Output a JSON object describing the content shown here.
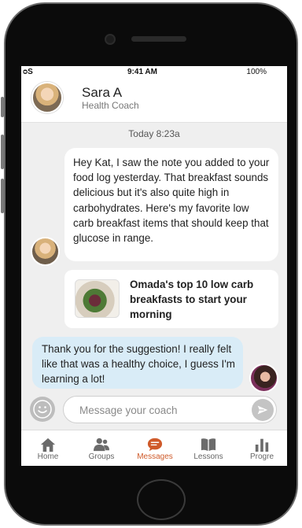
{
  "status_bar": {
    "signal": "ᴑS",
    "time": "9:41 AM",
    "battery": "100%"
  },
  "header": {
    "name": "Sara A",
    "role": "Health Coach"
  },
  "conversation": {
    "timestamp": "Today 8:23a",
    "coach_message": "Hey Kat, I saw the note you added to your food log yesterday. That breakfast sounds delicious but it's also quite high in carbohydrates. Here's my favorite low carb breakfast items that should keep that glucose in range.",
    "link_card_title": "Omada's top 10 low carb breakfasts to start your morning",
    "user_message": "Thank you for the suggestion! I really felt like that was a healthy choice, I guess I'm learning a lot!"
  },
  "composer": {
    "placeholder": "Message your coach",
    "value": ""
  },
  "tabs": [
    {
      "label": "Home",
      "icon": "home-icon"
    },
    {
      "label": "Groups",
      "icon": "groups-icon"
    },
    {
      "label": "Messages",
      "icon": "messages-icon",
      "active": true
    },
    {
      "label": "Lessons",
      "icon": "book-icon"
    },
    {
      "label": "Progre",
      "icon": "bar-chart-icon"
    }
  ],
  "colors": {
    "accent": "#cf5a2a",
    "user_bubble": "#d9ecf7",
    "tab_icon": "#6b6b6b"
  }
}
